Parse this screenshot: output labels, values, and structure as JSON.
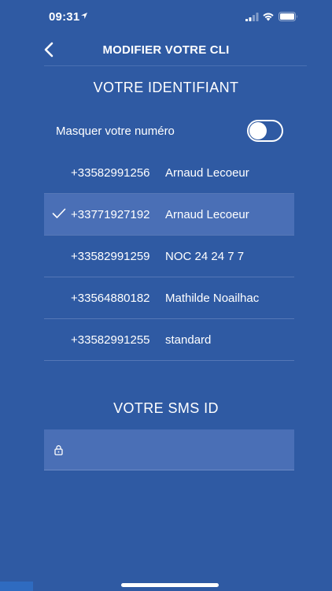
{
  "status": {
    "time": "09:31"
  },
  "nav": {
    "title": "MODIFIER VOTRE CLI"
  },
  "cli_section": {
    "title": "VOTRE IDENTIFIANT",
    "mask_label": "Masquer votre numéro",
    "mask_enabled": false,
    "rows": [
      {
        "number": "+33582991256",
        "name": "Arnaud Lecoeur",
        "selected": false
      },
      {
        "number": "+33771927192",
        "name": "Arnaud Lecoeur",
        "selected": true
      },
      {
        "number": "+33582991259",
        "name": "NOC 24 24 7 7",
        "selected": false
      },
      {
        "number": "+33564880182",
        "name": "Mathilde Noailhac",
        "selected": false
      },
      {
        "number": "+33582991255",
        "name": "standard",
        "selected": false
      }
    ]
  },
  "sms_section": {
    "title": "VOTRE SMS ID",
    "value": ""
  },
  "colors": {
    "background": "#2f5aa3",
    "selected_row": "#4a6fb6",
    "text": "#ffffff"
  }
}
